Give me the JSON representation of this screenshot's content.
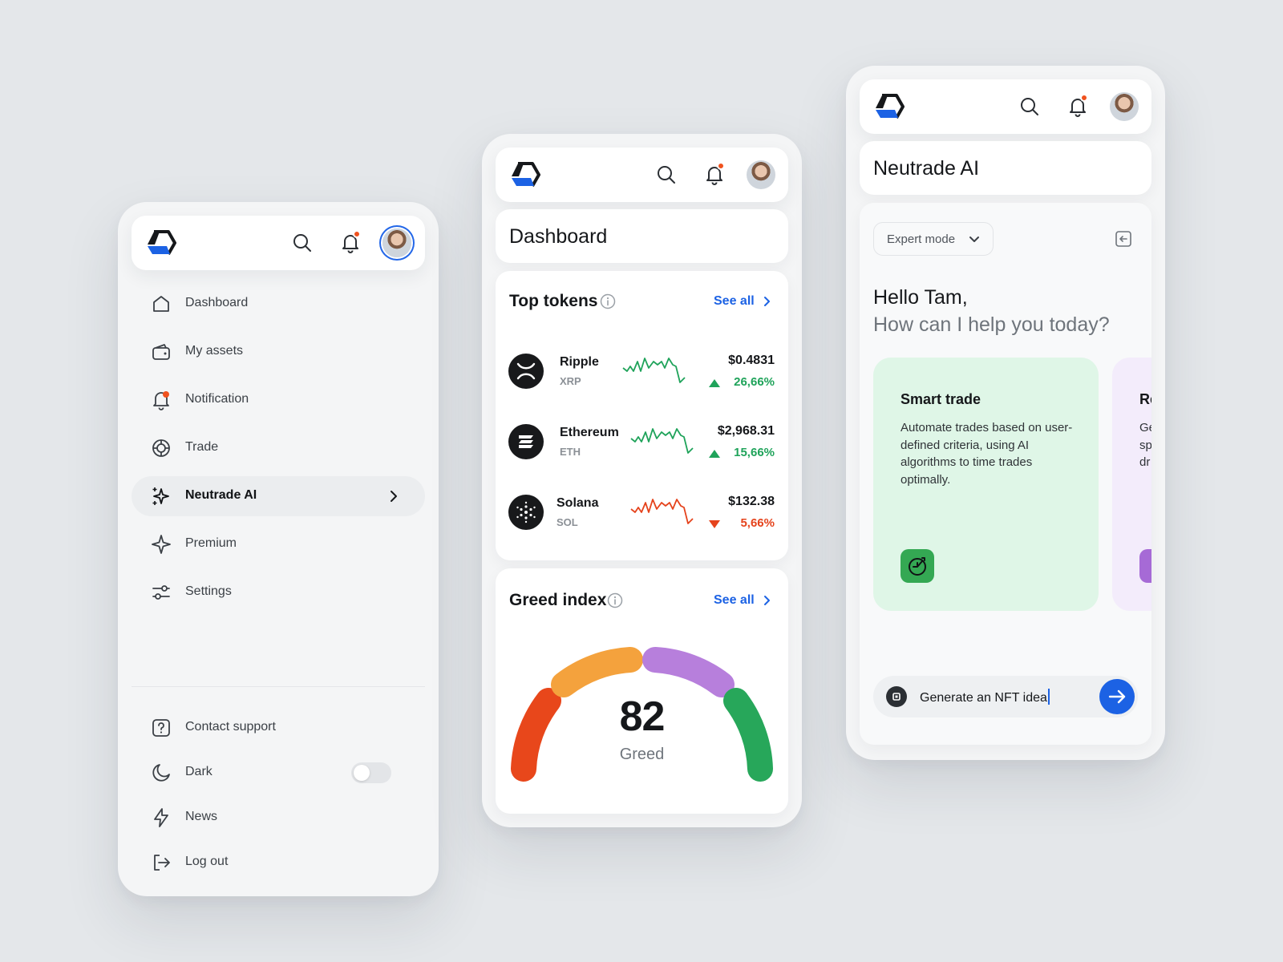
{
  "brand": {
    "accent": "#1c62e4",
    "logo_icon": "hexagon-logo-icon"
  },
  "topbar": {
    "search_icon": "search-icon",
    "bell_icon": "bell-icon",
    "avatar_icon": "avatar"
  },
  "menu": {
    "items": [
      {
        "label": "Dashboard",
        "icon": "home-icon"
      },
      {
        "label": "My assets",
        "icon": "wallet-icon"
      },
      {
        "label": "Notification",
        "icon": "bell-icon"
      },
      {
        "label": "Trade",
        "icon": "trade-icon"
      },
      {
        "label": "Neutrade AI",
        "icon": "sparkles-icon",
        "active": true
      },
      {
        "label": "Premium",
        "icon": "star-sparkle-icon"
      },
      {
        "label": "Settings",
        "icon": "sliders-icon"
      }
    ],
    "bottom": [
      {
        "label": "Contact support",
        "icon": "help-icon"
      },
      {
        "label": "Dark",
        "icon": "moon-icon",
        "toggle": false
      },
      {
        "label": "News",
        "icon": "lightning-icon"
      },
      {
        "label": "Log out",
        "icon": "logout-icon"
      }
    ]
  },
  "dashboard": {
    "title": "Dashboard",
    "top_tokens": {
      "title": "Top tokens",
      "see_all": "See all",
      "tokens": [
        {
          "name": "Ripple",
          "symbol": "XRP",
          "price": "$0.4831",
          "change": "26,66%",
          "direction": "up",
          "color": "#1fa35a"
        },
        {
          "name": "Ethereum",
          "symbol": "ETH",
          "price": "$2,968.31",
          "change": "15,66%",
          "direction": "up",
          "color": "#1fa35a"
        },
        {
          "name": "Solana",
          "symbol": "SOL",
          "price": "$132.38",
          "change": "5,66%",
          "direction": "down",
          "color": "#e5431c"
        }
      ]
    },
    "greed_index": {
      "title": "Greed index",
      "see_all": "See all",
      "value": "82",
      "label": "Greed",
      "segment_colors": [
        "#e8471b",
        "#f4a23d",
        "#b77fdc",
        "#27a75a"
      ]
    }
  },
  "ai": {
    "title": "Neutrade AI",
    "mode": "Expert mode",
    "greeting": "Hello Tam,",
    "question": "How can I help you today?",
    "cards": [
      {
        "title": "Smart trade",
        "desc": "Automate trades based on user-defined criteria, using AI algorithms to time trades optimally.",
        "bg": "#dff6e7",
        "icon_bg": "#34a853"
      },
      {
        "title": "Re",
        "desc": "Ge\nsp\ndr",
        "bg": "#f3ecfb",
        "icon_bg": "#a66ad6"
      }
    ],
    "input_value": "Generate an NFT idea"
  }
}
